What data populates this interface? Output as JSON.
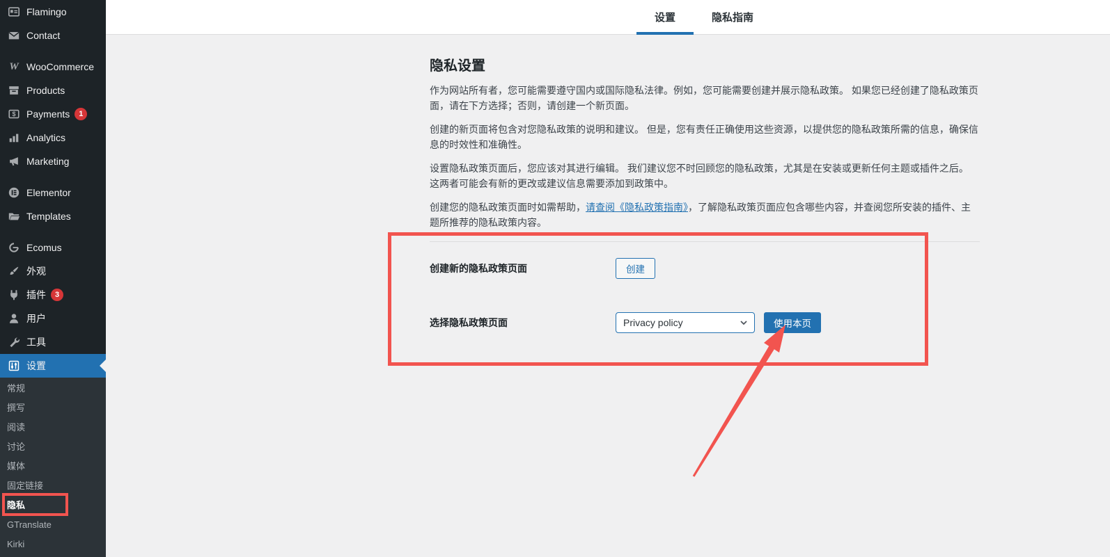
{
  "colors": {
    "accent": "#2271b1",
    "sidebar_bg": "#1d2327",
    "submenu_bg": "#2c3338",
    "content_bg": "#f0f0f1",
    "badge_red": "#d63638",
    "annotation_red": "#f2544f"
  },
  "icons": {
    "woocommerce_glyph": "W"
  },
  "sidebar": {
    "menu": [
      {
        "label": "Flamingo",
        "icon": "flamingo-icon"
      },
      {
        "label": "Contact",
        "icon": "mail-icon"
      },
      {
        "label": "WooCommerce",
        "icon": "woocommerce-icon"
      },
      {
        "label": "Products",
        "icon": "products-box-icon"
      },
      {
        "label": "Payments",
        "icon": "payments-icon",
        "badge": "1"
      },
      {
        "label": "Analytics",
        "icon": "analytics-bars-icon"
      },
      {
        "label": "Marketing",
        "icon": "megaphone-icon"
      },
      {
        "label": "Elementor",
        "icon": "elementor-icon"
      },
      {
        "label": "Templates",
        "icon": "folder-icon"
      },
      {
        "label": "Ecomus",
        "icon": "ecomus-icon"
      },
      {
        "label": "外观",
        "icon": "paintbrush-icon"
      },
      {
        "label": "插件",
        "icon": "plugin-icon",
        "badge": "3"
      },
      {
        "label": "用户",
        "icon": "users-icon"
      },
      {
        "label": "工具",
        "icon": "wrench-icon"
      },
      {
        "label": "设置",
        "icon": "settings-sliders-icon",
        "active": true
      }
    ],
    "submenu": [
      "常规",
      "撰写",
      "阅读",
      "讨论",
      "媒体",
      "固定链接",
      "隐私",
      "GTranslate",
      "Kirki"
    ],
    "current_submenu": "隐私"
  },
  "tabs": [
    {
      "label": "设置",
      "active": true
    },
    {
      "label": "隐私指南",
      "active": false
    }
  ],
  "content": {
    "title": "隐私设置",
    "p1": "作为网站所有者，您可能需要遵守国内或国际隐私法律。例如，您可能需要创建并展示隐私政策。 如果您已经创建了隐私政策页面，请在下方选择；否则，请创建一个新页面。",
    "p2": "创建的新页面将包含对您隐私政策的说明和建议。 但是，您有责任正确使用这些资源，以提供您的隐私政策所需的信息，确保信息的时效性和准确性。",
    "p3": "设置隐私政策页面后，您应该对其进行编辑。 我们建议您不时回顾您的隐私政策，尤其是在安装或更新任何主题或插件之后。 这两者可能会有新的更改或建议信息需要添加到政策中。",
    "p4_before": "创建您的隐私政策页面时如需帮助，",
    "p4_link": "请查阅《隐私政策指南》",
    "p4_after": "，了解隐私政策页面应包含哪些内容，并查阅您所安装的插件、主题所推荐的隐私政策内容。",
    "form": {
      "create_label": "创建新的隐私政策页面",
      "create_button": "创建",
      "select_label": "选择隐私政策页面",
      "select_value": "Privacy policy",
      "use_button": "使用本页"
    }
  }
}
